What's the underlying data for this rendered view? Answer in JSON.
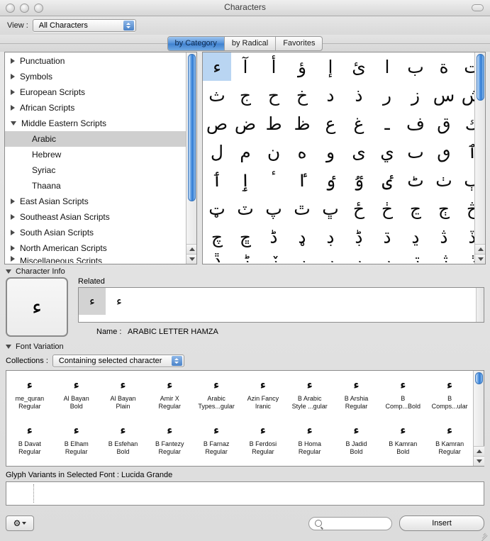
{
  "window": {
    "title": "Characters",
    "controls": [
      "close-button",
      "minimize-button",
      "zoom-button"
    ]
  },
  "view_bar": {
    "label": "View :",
    "selected": "All Characters"
  },
  "tabs": [
    {
      "label": "by Category",
      "active": true
    },
    {
      "label": "by Radical",
      "active": false
    },
    {
      "label": "Favorites",
      "active": false
    }
  ],
  "sidebar": {
    "items": [
      {
        "label": "Punctuation",
        "level": 0,
        "state": "collapsed",
        "selected": false
      },
      {
        "label": "Symbols",
        "level": 0,
        "state": "collapsed",
        "selected": false
      },
      {
        "label": "European Scripts",
        "level": 0,
        "state": "collapsed",
        "selected": false
      },
      {
        "label": "African Scripts",
        "level": 0,
        "state": "collapsed",
        "selected": false
      },
      {
        "label": "Middle Eastern Scripts",
        "level": 0,
        "state": "expanded",
        "selected": false
      },
      {
        "label": "Arabic",
        "level": 1,
        "state": "leaf",
        "selected": true
      },
      {
        "label": "Hebrew",
        "level": 1,
        "state": "leaf",
        "selected": false
      },
      {
        "label": "Syriac",
        "level": 1,
        "state": "leaf",
        "selected": false
      },
      {
        "label": "Thaana",
        "level": 1,
        "state": "leaf",
        "selected": false
      },
      {
        "label": "East Asian Scripts",
        "level": 0,
        "state": "collapsed",
        "selected": false
      },
      {
        "label": "Southeast Asian Scripts",
        "level": 0,
        "state": "collapsed",
        "selected": false
      },
      {
        "label": "South Asian Scripts",
        "level": 0,
        "state": "collapsed",
        "selected": false
      },
      {
        "label": "North American Scripts",
        "level": 0,
        "state": "collapsed",
        "selected": false
      },
      {
        "label": "Miscellaneous Scripts",
        "level": 0,
        "state": "collapsed",
        "selected": false,
        "clipped": true
      }
    ]
  },
  "char_grid": {
    "columns": 10,
    "selected_index": 0,
    "cells": [
      "ء",
      "آ",
      "أ",
      "ؤ",
      "إ",
      "ئ",
      "ا",
      "ب",
      "ة",
      "ت",
      "ث",
      "ج",
      "ح",
      "خ",
      "د",
      "ذ",
      "ر",
      "ز",
      "س",
      "ش",
      "ص",
      "ض",
      "ط",
      "ظ",
      "ع",
      "غ",
      "ـ",
      "ف",
      "ق",
      "ك",
      "ل",
      "م",
      "ن",
      "ه",
      "و",
      "ى",
      "ي",
      "ٮ",
      "ٯ",
      "ٱ",
      "ٲ",
      "ٳ",
      "ٴ",
      "ٵ",
      "ٶ",
      "ٷ",
      "ٸ",
      "ٹ",
      "ٺ",
      "ٻ",
      "ټ",
      "ٽ",
      "پ",
      "ٿ",
      "ڀ",
      "ځ",
      "ڂ",
      "ڃ",
      "ڄ",
      "څ",
      "چ",
      "ڇ",
      "ڈ",
      "ډ",
      "ڊ",
      "ڋ",
      "ڌ",
      "ڍ",
      "ڎ",
      "ڏ",
      "ڐ",
      "ڑ",
      "ڒ",
      "ړ",
      "ڔ",
      "ڕ",
      "ږ",
      "ڗ",
      "ژ",
      "ڙ"
    ]
  },
  "character_info": {
    "section_label": "Character Info",
    "preview_glyph": "ء",
    "related_label": "Related",
    "related_glyphs": [
      "ء",
      "ﺀ"
    ],
    "related_selected_index": 0,
    "name_label": "Name :",
    "name_value": "ARABIC LETTER HAMZA"
  },
  "font_variation": {
    "section_label": "Font Variation",
    "collections_label": "Collections :",
    "collections_selected": "Containing selected character",
    "fonts": [
      {
        "glyph": "ء",
        "line1": "me_quran",
        "line2": "Regular"
      },
      {
        "glyph": "ء",
        "line1": "Al Bayan",
        "line2": "Bold"
      },
      {
        "glyph": "ء",
        "line1": "Al Bayan",
        "line2": "Plain"
      },
      {
        "glyph": "ء",
        "line1": "Amir X",
        "line2": "Regular"
      },
      {
        "glyph": "ء",
        "line1": "Arabic",
        "line2": "Types...gular"
      },
      {
        "glyph": "ء",
        "line1": "Azin Fancy",
        "line2": "Iranic"
      },
      {
        "glyph": "ء",
        "line1": "B Arabic",
        "line2": "Style ...gular"
      },
      {
        "glyph": "ء",
        "line1": "B Arshia",
        "line2": "Regular"
      },
      {
        "glyph": "ء",
        "line1": "B",
        "line2": "Comp...Bold"
      },
      {
        "glyph": "ء",
        "line1": "B",
        "line2": "Comps...ular"
      },
      {
        "glyph": "ء",
        "line1": "B Davat",
        "line2": "Regular"
      },
      {
        "glyph": "ء",
        "line1": "B Elham",
        "line2": "Regular"
      },
      {
        "glyph": "ء",
        "line1": "B Esfehan",
        "line2": "Bold"
      },
      {
        "glyph": "ء",
        "line1": "B Fantezy",
        "line2": "Regular"
      },
      {
        "glyph": "ء",
        "line1": "B Farnaz",
        "line2": "Regular"
      },
      {
        "glyph": "ء",
        "line1": "B Ferdosi",
        "line2": "Regular"
      },
      {
        "glyph": "ء",
        "line1": "B Homa",
        "line2": "Regular"
      },
      {
        "glyph": "ء",
        "line1": "B Jadid",
        "line2": "Bold"
      },
      {
        "glyph": "ء",
        "line1": "B Kamran",
        "line2": "Bold"
      },
      {
        "glyph": "ء",
        "line1": "B Kamran",
        "line2": "Regular"
      }
    ]
  },
  "glyph_variants": {
    "label": "Glyph Variants in Selected Font : Lucida Grande"
  },
  "footer": {
    "gear_icon": "gear-icon",
    "search_placeholder": "",
    "insert_label": "Insert"
  },
  "colors": {
    "selection_blue": "#b9d5f2",
    "row_selection_gray": "#cfcfcf",
    "tab_active_blue": "#4f8ed8",
    "scrollbar_blue": "#4e93e0"
  }
}
